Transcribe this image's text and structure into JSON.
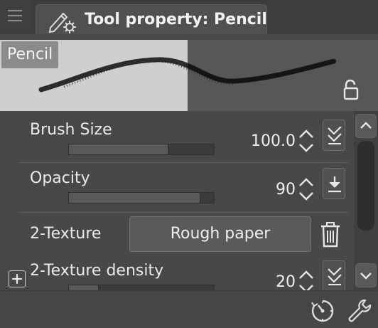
{
  "header": {
    "tab_title": "Tool property: Pencil"
  },
  "preview": {
    "preset_label": "Pencil"
  },
  "properties": {
    "brush_size": {
      "label": "Brush Size",
      "value": "100.0",
      "fill_fraction": 0.68
    },
    "opacity": {
      "label": "Opacity",
      "value": "90",
      "fill_fraction": 0.9
    },
    "texture": {
      "label": "2-Texture",
      "value": "Rough paper"
    },
    "texture_density": {
      "label": "2-Texture density",
      "value": "20",
      "fill_fraction": 0.2
    }
  },
  "icons": {
    "menu": "hamburger-icon",
    "tool": "pencil-settings-icon",
    "lock": "lock-icon",
    "pressure": "pressure-check-icon",
    "download": "download-arrow-icon",
    "trash": "trash-icon",
    "plus": "plus-icon",
    "timer": "clock-icon",
    "wrench": "wrench-icon"
  },
  "colors": {
    "panel_bg": "#484848",
    "preview_light": "#cfcfcf",
    "preview_dark": "#575757"
  }
}
